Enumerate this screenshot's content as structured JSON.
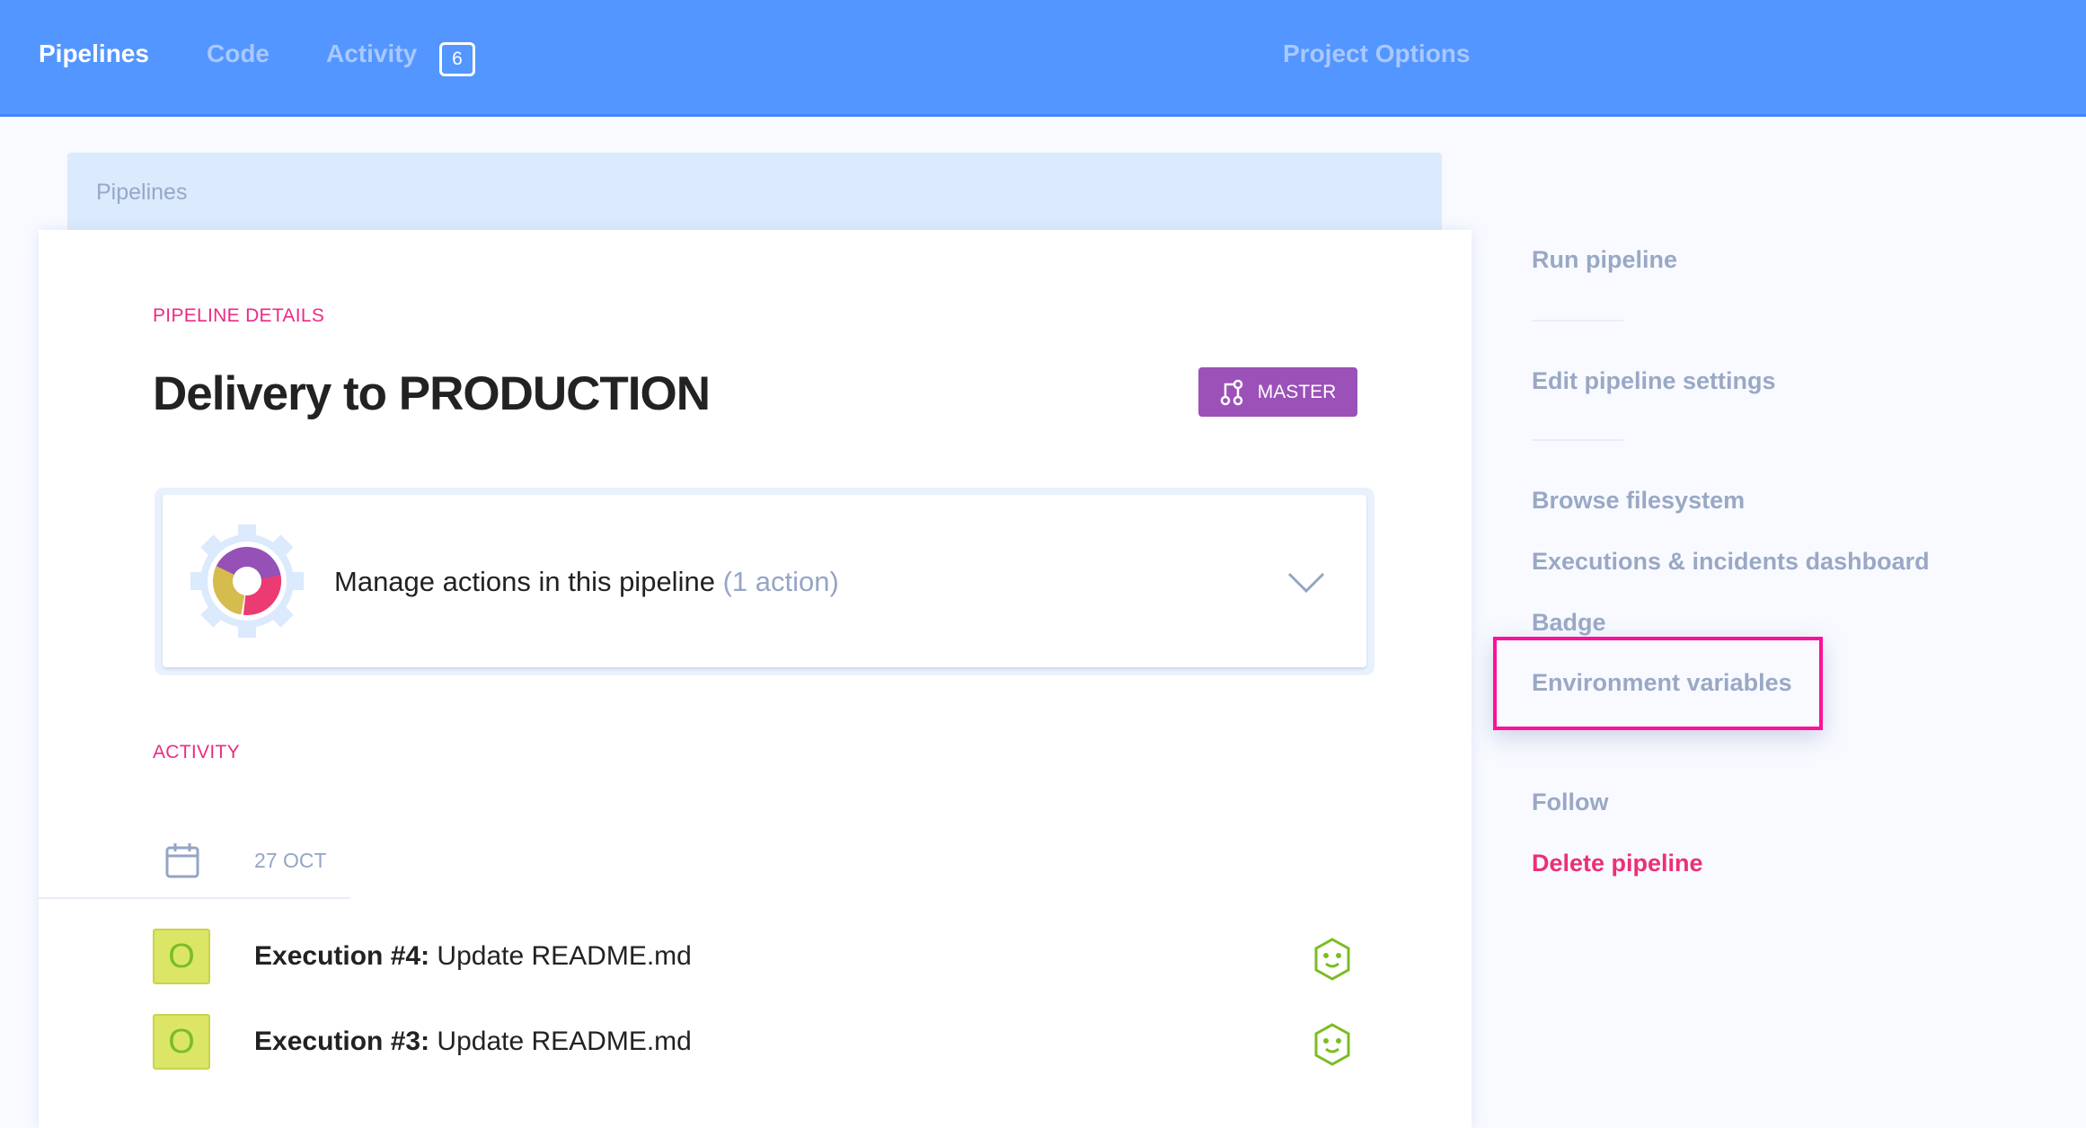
{
  "header": {
    "tabs": [
      {
        "label": "Pipelines",
        "active": true
      },
      {
        "label": "Code"
      },
      {
        "label": "Activity",
        "badge": "6"
      }
    ],
    "project_options": "Project Options"
  },
  "breadcrumb": "Pipelines",
  "main": {
    "section_label": "PIPELINE DETAILS",
    "title": "Delivery to PRODUCTION",
    "branch_button": {
      "label": "MASTER",
      "icon": "branch-icon"
    },
    "actions": {
      "text": "Manage actions in this pipeline",
      "count": "(1 action)",
      "icon": "gear-icon"
    },
    "activity_label": "ACTIVITY",
    "date": "27 OCT",
    "executions": [
      {
        "status": "O",
        "title": "Execution #4:",
        "message": "Update README.md",
        "icon": "smiley-icon"
      },
      {
        "status": "O",
        "title": "Execution #3:",
        "message": "Update README.md",
        "icon": "smiley-icon"
      }
    ]
  },
  "sidebar": {
    "items": [
      "Run pipeline",
      "Edit pipeline settings",
      "Browse filesystem",
      "Executions & incidents dashboard",
      "Badge",
      "Environment variables",
      "Follow",
      "Delete pipeline"
    ]
  },
  "colors": {
    "header": "#5396ff",
    "accent_pink": "#ec2a85",
    "branch": "#9b51b8",
    "highlight": "#ff0f9b",
    "success": "#7bbd24"
  }
}
